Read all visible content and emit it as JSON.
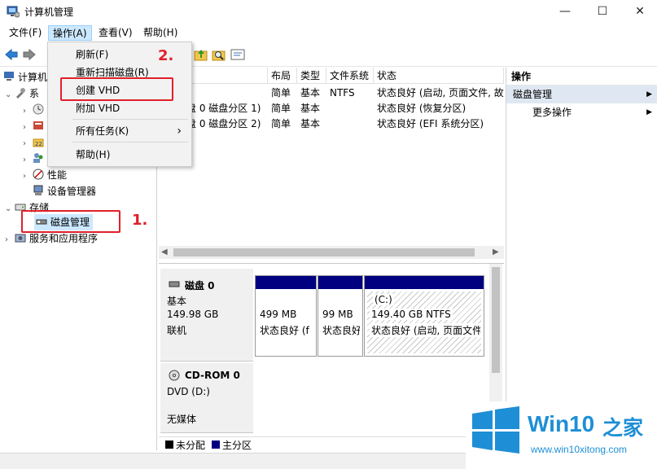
{
  "window": {
    "title": "计算机管理",
    "minimize": "—",
    "maximize": "☐",
    "close": "✕"
  },
  "menubar": {
    "file": "文件(F)",
    "action": "操作(A)",
    "view": "查看(V)",
    "help": "帮助(H)"
  },
  "dropdown": {
    "items": [
      "刷新(F)",
      "重新扫描磁盘(R)",
      "创建 VHD",
      "附加 VHD",
      "所有任务(K)",
      "帮助(H)"
    ],
    "submenu_arrow": "›"
  },
  "tree": {
    "root": "计算机",
    "system_partial": "系",
    "performance": "性能",
    "device_manager": "设备管理器",
    "storage": "存储",
    "disk_management": "磁盘管理",
    "services": "服务和应用程序"
  },
  "volume_list": {
    "headers": [
      "布局",
      "类型",
      "文件系统",
      "状态"
    ],
    "rows": [
      {
        "name": ")",
        "layout": "简单",
        "type": "基本",
        "fs": "NTFS",
        "status": "状态良好 (启动, 页面文件, 故"
      },
      {
        "name": "盘 0 磁盘分区 1)",
        "layout": "简单",
        "type": "基本",
        "fs": "",
        "status": "状态良好 (恢复分区)"
      },
      {
        "name": "盘 0 磁盘分区 2)",
        "layout": "简单",
        "type": "基本",
        "fs": "",
        "status": "状态良好 (EFI 系统分区)"
      }
    ]
  },
  "disks": {
    "disk0": {
      "name": "磁盘 0",
      "kind": "基本",
      "size": "149.98 GB",
      "state": "联机",
      "partitions": [
        {
          "size": "499 MB",
          "status": "状态良好 (f"
        },
        {
          "size": "99 MB",
          "status": "状态良好"
        },
        {
          "label": "(C:)",
          "size": "149.40 GB NTFS",
          "status": "状态良好 (启动, 页面文件"
        }
      ]
    },
    "cdrom": {
      "name": "CD-ROM 0",
      "drive": "DVD (D:)",
      "media": "无媒体"
    }
  },
  "legend": {
    "unallocated": "未分配",
    "primary": "主分区"
  },
  "actions_pane": {
    "header": "操作",
    "section": "磁盘管理",
    "more": "更多操作",
    "arrow": "▶"
  },
  "annotations": {
    "step1": "1.",
    "step2": "2."
  },
  "watermark": {
    "brand_win": "Win10",
    "brand_zh": "之家",
    "url": "www.win10xitong.com"
  },
  "colors": {
    "primary_partition": "#000080",
    "annotation_red": "#e0202a",
    "selection": "#cce8ff",
    "win_blue": "#1e8fd6"
  }
}
